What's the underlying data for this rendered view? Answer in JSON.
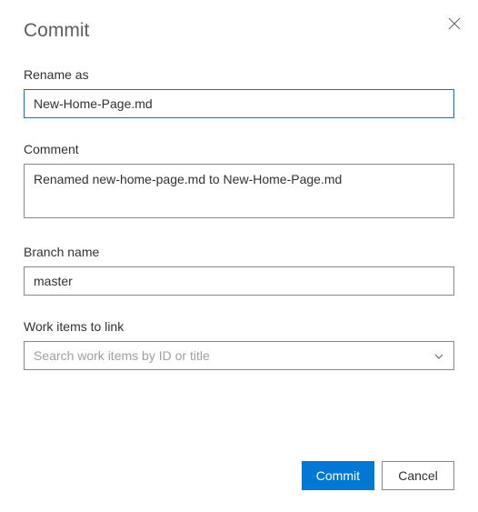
{
  "dialog": {
    "title": "Commit"
  },
  "fields": {
    "rename": {
      "label": "Rename as",
      "value": "New-Home-Page.md"
    },
    "comment": {
      "label": "Comment",
      "value": "Renamed new-home-page.md to New-Home-Page.md"
    },
    "branch": {
      "label": "Branch name",
      "value": "master"
    },
    "workitems": {
      "label": "Work items to link",
      "placeholder": "Search work items by ID or title"
    }
  },
  "buttons": {
    "commit": "Commit",
    "cancel": "Cancel"
  }
}
